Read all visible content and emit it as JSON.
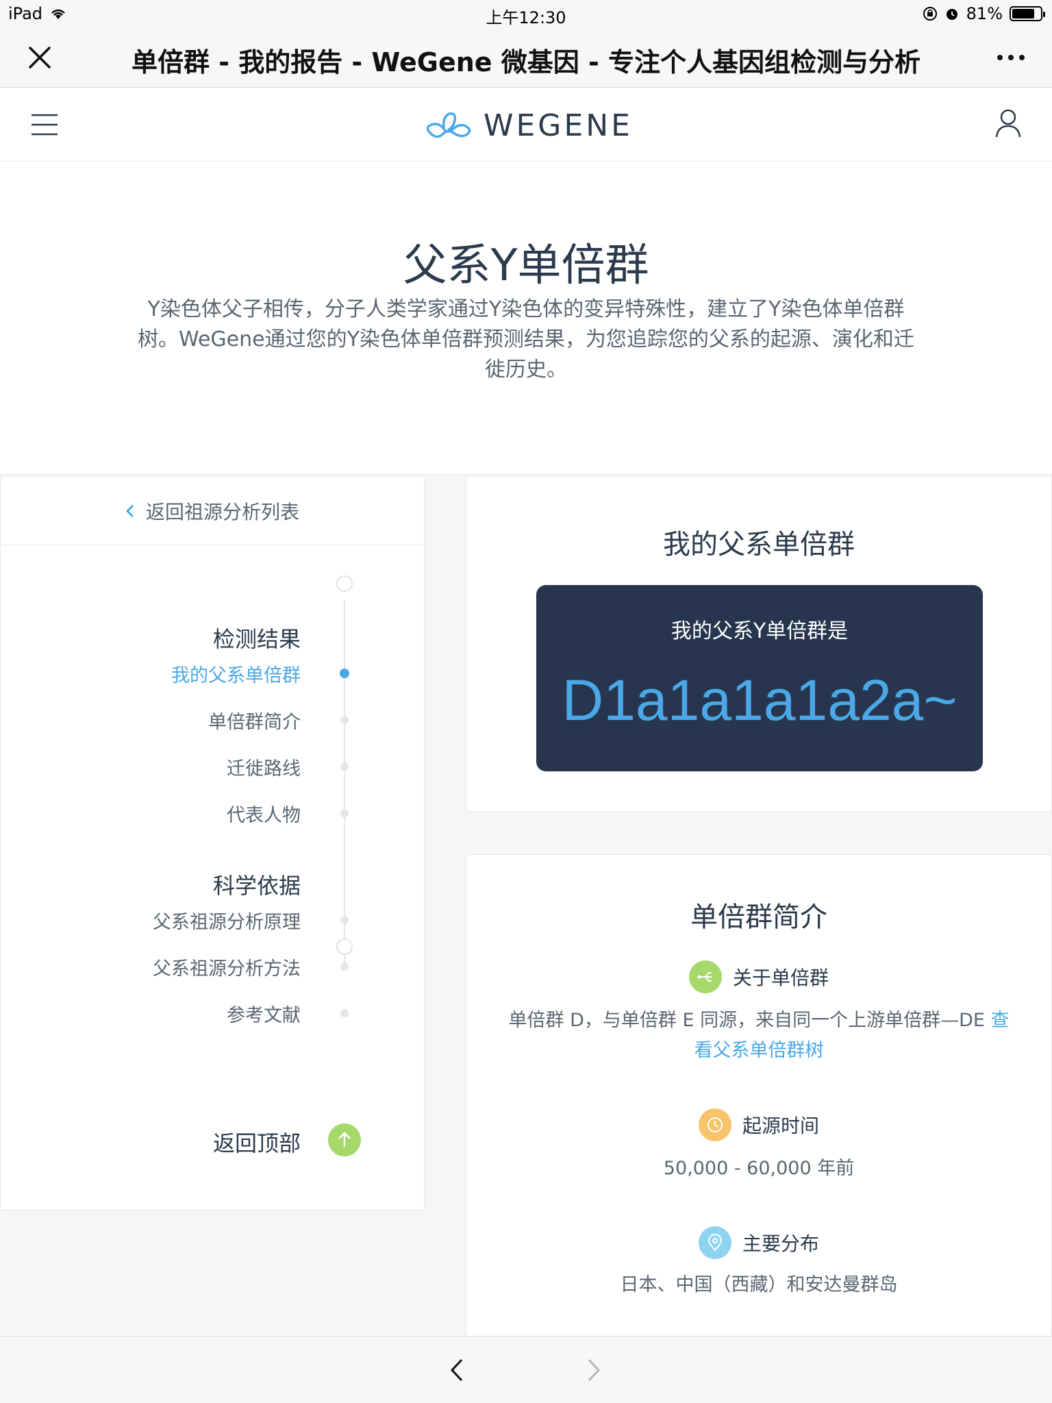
{
  "status_bar": {
    "device": "iPad",
    "time": "上午12:30",
    "battery_percent": "81%",
    "battery_level": 0.81
  },
  "nav_bar": {
    "title": "单倍群 - 我的报告 - WeGene 微基因 - 专注个人基因组检测与分析"
  },
  "site_header": {
    "logo_text": "WEGENE",
    "brand_color": "#4aa8e8"
  },
  "hero": {
    "title": "父系Y单倍群",
    "description": "Y染色体父子相传，分子人类学家通过Y染色体的变异特殊性，建立了Y染色体单倍群树。WeGene通过您的Y染色体单倍群预测结果，为您追踪您的父系的起源、演化和迁徙历史。"
  },
  "sidebar": {
    "back_label": "返回祖源分析列表",
    "toc": [
      {
        "label": "检测结果",
        "kind": "heading"
      },
      {
        "label": "我的父系单倍群",
        "kind": "item",
        "active": true
      },
      {
        "label": "单倍群简介",
        "kind": "item"
      },
      {
        "label": "迁徙路线",
        "kind": "item"
      },
      {
        "label": "代表人物",
        "kind": "item"
      },
      {
        "label": "科学依据",
        "kind": "heading"
      },
      {
        "label": "父系祖源分析原理",
        "kind": "item"
      },
      {
        "label": "父系祖源分析方法",
        "kind": "item"
      },
      {
        "label": "参考文献",
        "kind": "item"
      }
    ],
    "back_to_top": "返回顶部"
  },
  "result_card": {
    "title": "我的父系单倍群",
    "box_label": "我的父系Y单倍群是",
    "haplogroup": "D1a1a1a1a2a~"
  },
  "intro_card": {
    "title": "单倍群简介",
    "about": {
      "heading": "关于单倍群",
      "text": "单倍群 D，与单倍群 E 同源，来自同一个上游单倍群—DE ",
      "link": "查看父系单倍群树",
      "icon": "branch-icon",
      "icon_color": "#a6d86a"
    },
    "origin": {
      "heading": "起源时间",
      "text": "50,000 - 60,000 年前",
      "icon": "clock-icon",
      "icon_color": "#f7c36b"
    },
    "distribution": {
      "heading": "主要分布",
      "text": "日本、中国（西藏）和安达曼群岛",
      "icon": "location-pin-icon",
      "icon_color": "#8fd3f0"
    }
  }
}
